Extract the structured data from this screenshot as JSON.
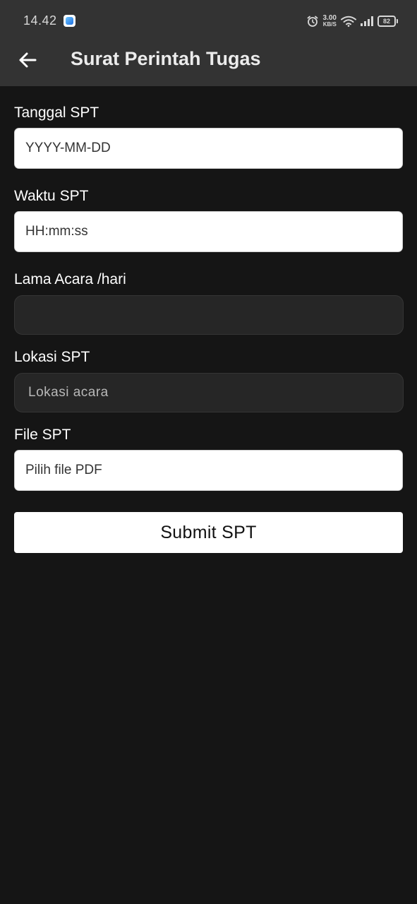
{
  "status_bar": {
    "time": "14.42",
    "net_speed_value": "3.00",
    "net_speed_unit": "KB/S",
    "battery": "82",
    "icons": [
      "app-notification-icon",
      "alarm-icon",
      "wifi-icon",
      "signal-icon",
      "battery-icon"
    ]
  },
  "app_bar": {
    "title": "Surat Perintah Tugas",
    "back_icon": "arrow-left-icon"
  },
  "form": {
    "tanggal": {
      "label": "Tanggal SPT",
      "value": "YYYY-MM-DD"
    },
    "waktu": {
      "label": "Waktu SPT",
      "value": "HH:mm:ss"
    },
    "lama": {
      "label": "Lama Acara /hari",
      "value": ""
    },
    "lokasi": {
      "label": "Lokasi SPT",
      "placeholder": "Lokasi acara"
    },
    "file": {
      "label": "File SPT",
      "value": "Pilih file PDF"
    },
    "submit_label": "Submit SPT"
  },
  "colors": {
    "background": "#151515",
    "app_bar": "#333333",
    "input_light": "#ffffff",
    "input_dark": "#262626"
  }
}
